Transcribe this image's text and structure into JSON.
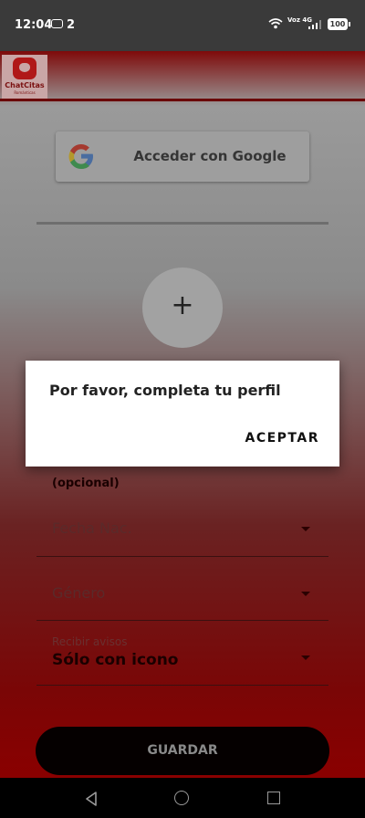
{
  "status_bar": {
    "time": "12:04",
    "message_count": "2",
    "network": "Voz 4G",
    "battery": "100"
  },
  "app": {
    "logo_title": "ChatCitas",
    "logo_subtitle": "Románticas"
  },
  "google_button": {
    "label": "Acceder con Google"
  },
  "photo_button": {
    "symbol": "+"
  },
  "form": {
    "optional_label": "(opcional)",
    "birthdate": {
      "placeholder": "Fecha Nac."
    },
    "gender": {
      "placeholder": "Género"
    },
    "notifications": {
      "label": "Recibir avisos",
      "value": "Sólo con icono"
    },
    "save_label": "GUARDAR"
  },
  "dialog": {
    "message": "Por favor, completa tu perfil",
    "accept_label": "ACEPTAR"
  },
  "colors": {
    "brand_red": "#8a0000",
    "dialog_bg": "#ffffff"
  }
}
